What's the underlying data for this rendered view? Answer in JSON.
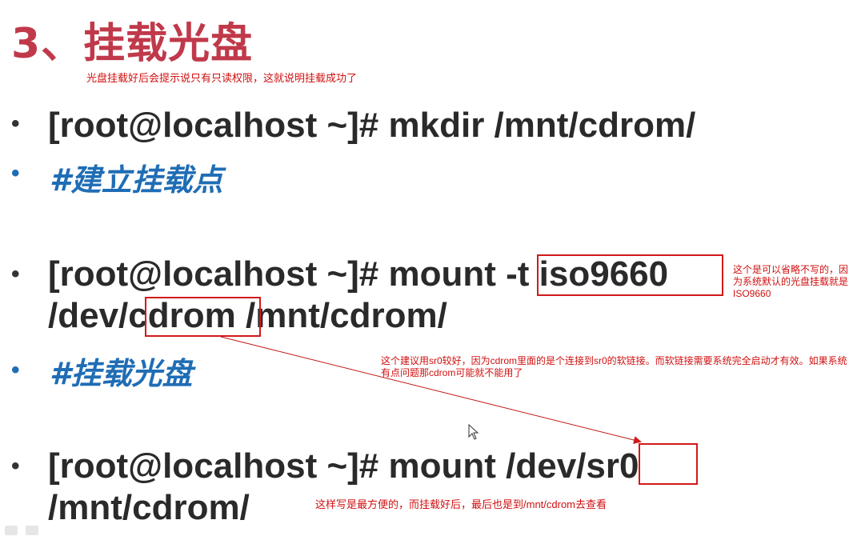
{
  "title": "3、挂载光盘",
  "notes": {
    "top": "光盘挂载好后会提示说只有只读权限，这就说明挂载成功了",
    "right_line1": "这个是可以省略不写的，因",
    "right_line2": "为系统默认的光盘挂载就是",
    "right_line3": "ISO9660",
    "middle_line1": "这个建议用sr0较好，因为cdrom里面的是个连接到sr0的软链接。而软链接需要系统完全启动才有效。如果系统",
    "middle_line2": "有点问题那cdrom可能就不能用了",
    "bottom": "这样写是最方便的，而挂载好后，最后也是到/mnt/cdrom去查看"
  },
  "bullets": [
    "•",
    "•",
    "•",
    "•",
    "•"
  ],
  "commands": {
    "mkdir": "[root@localhost ~]# mkdir /mnt/cdrom/",
    "mkdir_comment": "#建立挂载点",
    "mount1_prefix": "[root@localhost ~]# mount ",
    "mount1_option": "-t iso9660",
    "mount1_line2_prefix": "/dev/",
    "mount1_device": "cdrom",
    "mount1_line2_suffix": " /mnt/cdrom/",
    "mount1_comment": "#挂载光盘",
    "mount2_prefix": "[root@localhost ~]# mount /dev/",
    "mount2_device": "sr0",
    "mount2_line2": "/mnt/cdrom/"
  },
  "colors": {
    "title": "#c0394a",
    "annotation": "#d01010",
    "comment": "#1f6db5",
    "command": "#2a2a2a"
  }
}
